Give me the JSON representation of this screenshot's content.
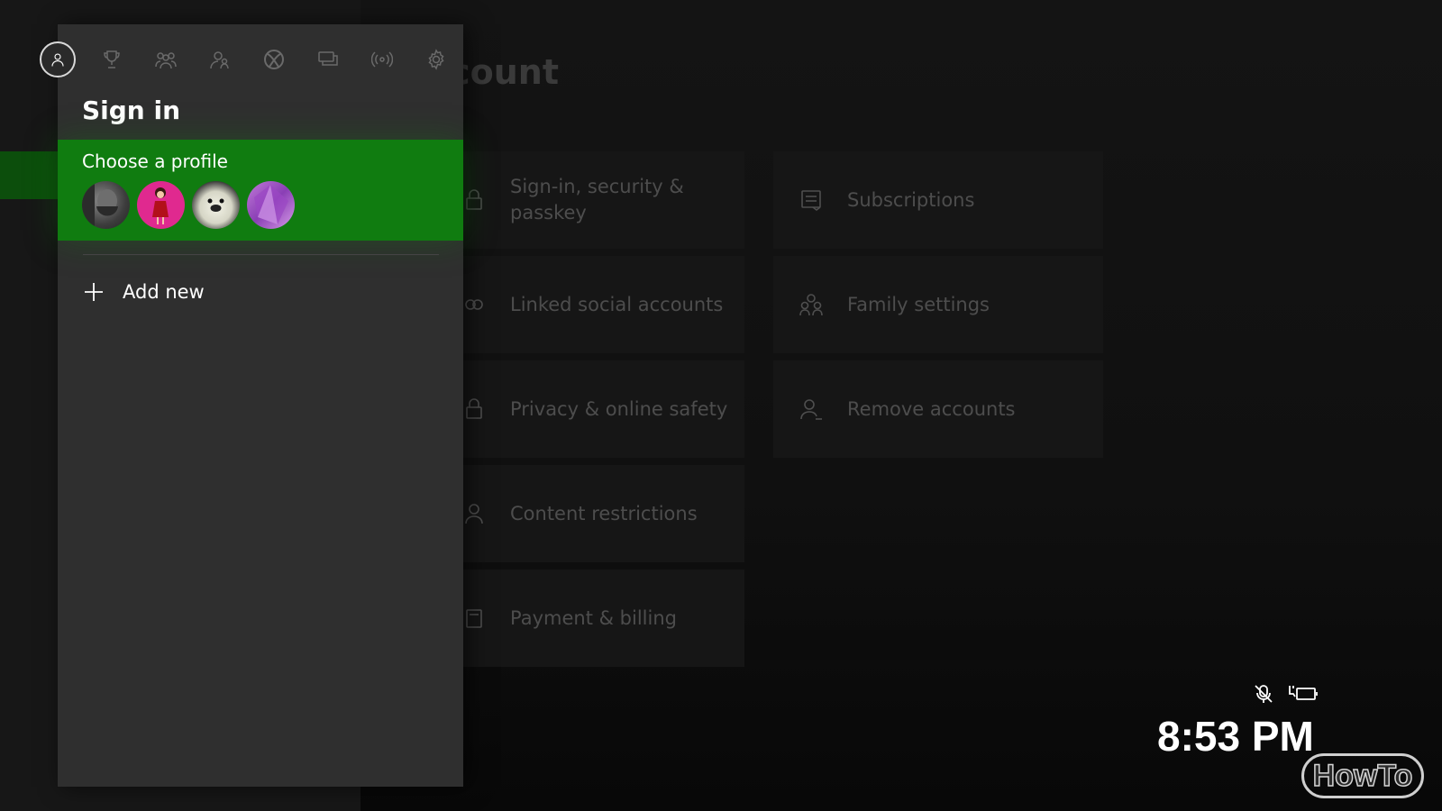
{
  "page": {
    "title_partial": "count"
  },
  "settings_tiles": {
    "left": [
      {
        "label": "Sign-in, security & passkey",
        "icon": "lock-icon"
      },
      {
        "label": "Linked social accounts",
        "icon": "link-icon"
      },
      {
        "label": "Privacy & online safety",
        "icon": "lock-icon"
      },
      {
        "label": "Content restrictions",
        "icon": "person-icon"
      },
      {
        "label": "Payment & billing",
        "icon": "card-icon"
      }
    ],
    "right": [
      {
        "label": "Subscriptions",
        "icon": "subscriptions-icon"
      },
      {
        "label": "Family settings",
        "icon": "family-icon"
      },
      {
        "label": "Remove accounts",
        "icon": "remove-person-icon"
      }
    ]
  },
  "guide": {
    "tabs": [
      {
        "icon": "profile-icon",
        "active": true
      },
      {
        "icon": "trophy-icon",
        "active": false
      },
      {
        "icon": "friends-icon",
        "active": false
      },
      {
        "icon": "party-icon",
        "active": false
      },
      {
        "icon": "xbox-icon",
        "active": false
      },
      {
        "icon": "messages-icon",
        "active": false
      },
      {
        "icon": "broadcast-icon",
        "active": false
      },
      {
        "icon": "gear-icon",
        "active": false
      }
    ],
    "title": "Sign in",
    "profile_section": {
      "label": "Choose a profile",
      "avatars": [
        "avatar-bearded-man",
        "avatar-pink-character",
        "avatar-white-creature",
        "avatar-purple-gem"
      ]
    },
    "add_new_label": "Add new"
  },
  "status": {
    "icons": [
      "mic-muted-icon",
      "battery-charging-icon"
    ],
    "time": "8:53 PM"
  },
  "watermark": "HowTo",
  "colors": {
    "accent_green": "#107c10",
    "panel": "#2f2f2f",
    "background": "#0f0f0f"
  }
}
